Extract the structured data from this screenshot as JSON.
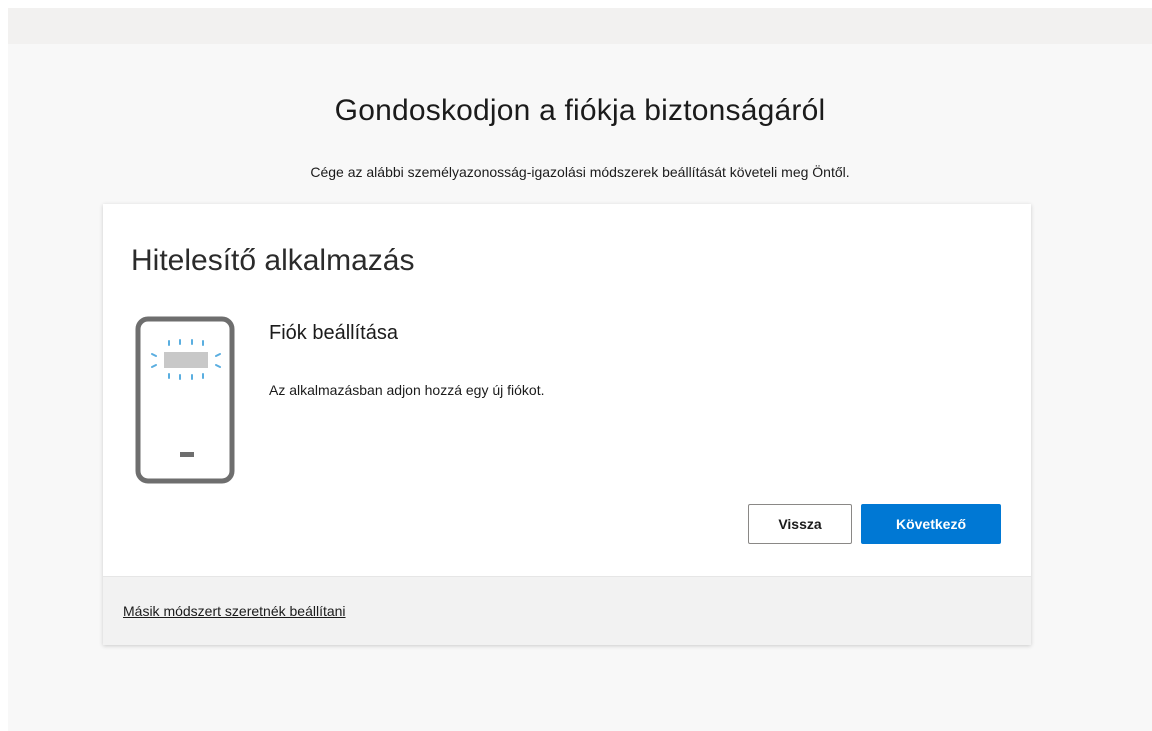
{
  "page": {
    "title": "Gondoskodjon a fiókja biztonságáról",
    "subtitle": "Cége az alábbi személyazonosság-igazolási módszerek beállítását követeli meg Öntől."
  },
  "card": {
    "title": "Hitelesítő alkalmazás",
    "step_title": "Fiók beállítása",
    "step_description": "Az alkalmazásban adjon hozzá egy új fiókot.",
    "phone_icon": "phone-qr-scan-icon",
    "back_label": "Vissza",
    "next_label": "Következő",
    "alt_method_link": "Másik módszert szeretnék beállítani"
  },
  "colors": {
    "primary": "#0078d4",
    "scan_accent": "#5aaee0",
    "phone_frame": "#6e6e6e",
    "background": "#f8f8f8",
    "footer": "#f2f2f2"
  }
}
